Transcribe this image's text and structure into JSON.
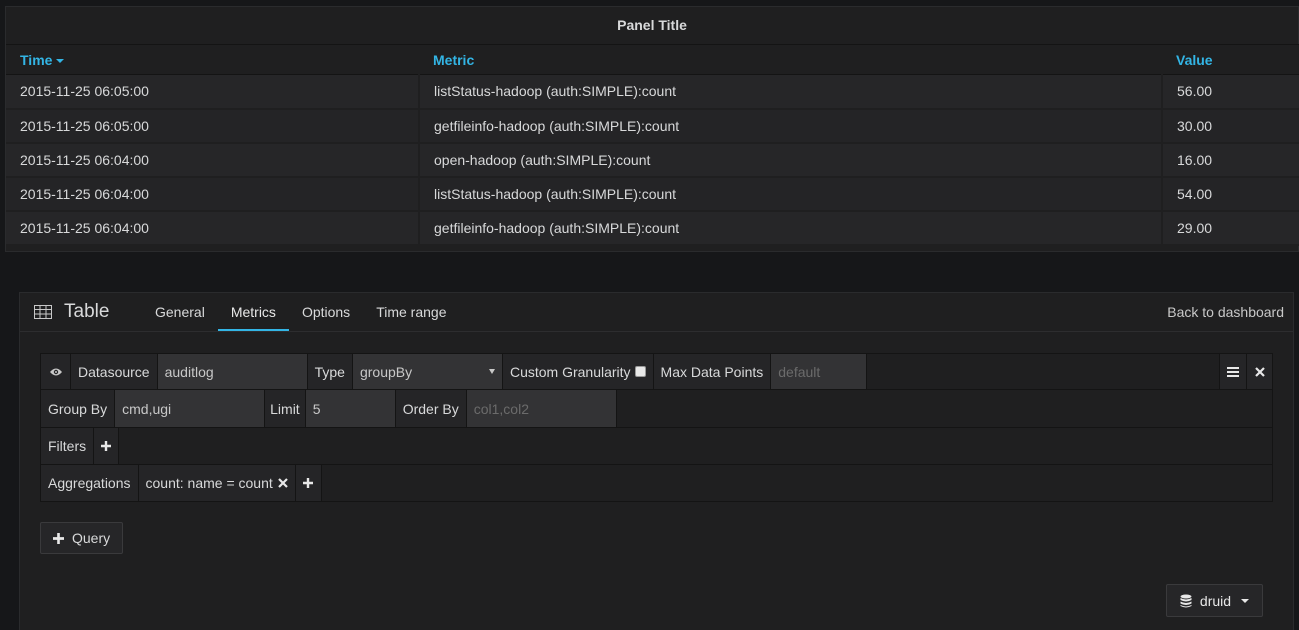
{
  "panel": {
    "title": "Panel Title",
    "columns": [
      "Time",
      "Metric",
      "Value"
    ],
    "rows": [
      {
        "time": "2015-11-25 06:05:00",
        "metric": "listStatus-hadoop (auth:SIMPLE):count",
        "value": "56.00"
      },
      {
        "time": "2015-11-25 06:05:00",
        "metric": "getfileinfo-hadoop (auth:SIMPLE):count",
        "value": "30.00"
      },
      {
        "time": "2015-11-25 06:04:00",
        "metric": "open-hadoop (auth:SIMPLE):count",
        "value": "16.00"
      },
      {
        "time": "2015-11-25 06:04:00",
        "metric": "listStatus-hadoop (auth:SIMPLE):count",
        "value": "54.00"
      },
      {
        "time": "2015-11-25 06:04:00",
        "metric": "getfileinfo-hadoop (auth:SIMPLE):count",
        "value": "29.00"
      }
    ]
  },
  "editor": {
    "title": "Table",
    "tabs": [
      "General",
      "Metrics",
      "Options",
      "Time range"
    ],
    "active_tab": "Metrics",
    "back_label": "Back to dashboard",
    "query": {
      "datasource_label": "Datasource",
      "datasource_value": "auditlog",
      "type_label": "Type",
      "type_value": "groupBy",
      "granularity_label": "Custom Granularity",
      "max_points_label": "Max Data Points",
      "max_points_placeholder": "default",
      "group_by_label": "Group By",
      "group_by_value": "cmd,ugi",
      "limit_label": "Limit",
      "limit_value": "5",
      "order_by_label": "Order By",
      "order_by_placeholder": "col1,col2",
      "filters_label": "Filters",
      "aggregations_label": "Aggregations",
      "aggregation_item": "count: name = count"
    },
    "add_query_label": "Query",
    "datasource_button": "druid"
  },
  "colors": {
    "accent": "#33b5e5",
    "background": "#161719",
    "panel": "#1f1f20"
  },
  "icons": [
    "sort-desc-icon",
    "table-grid-icon",
    "eye-icon",
    "hamburger-icon",
    "close-icon",
    "plus-icon",
    "database-icon",
    "caret-down-icon"
  ]
}
